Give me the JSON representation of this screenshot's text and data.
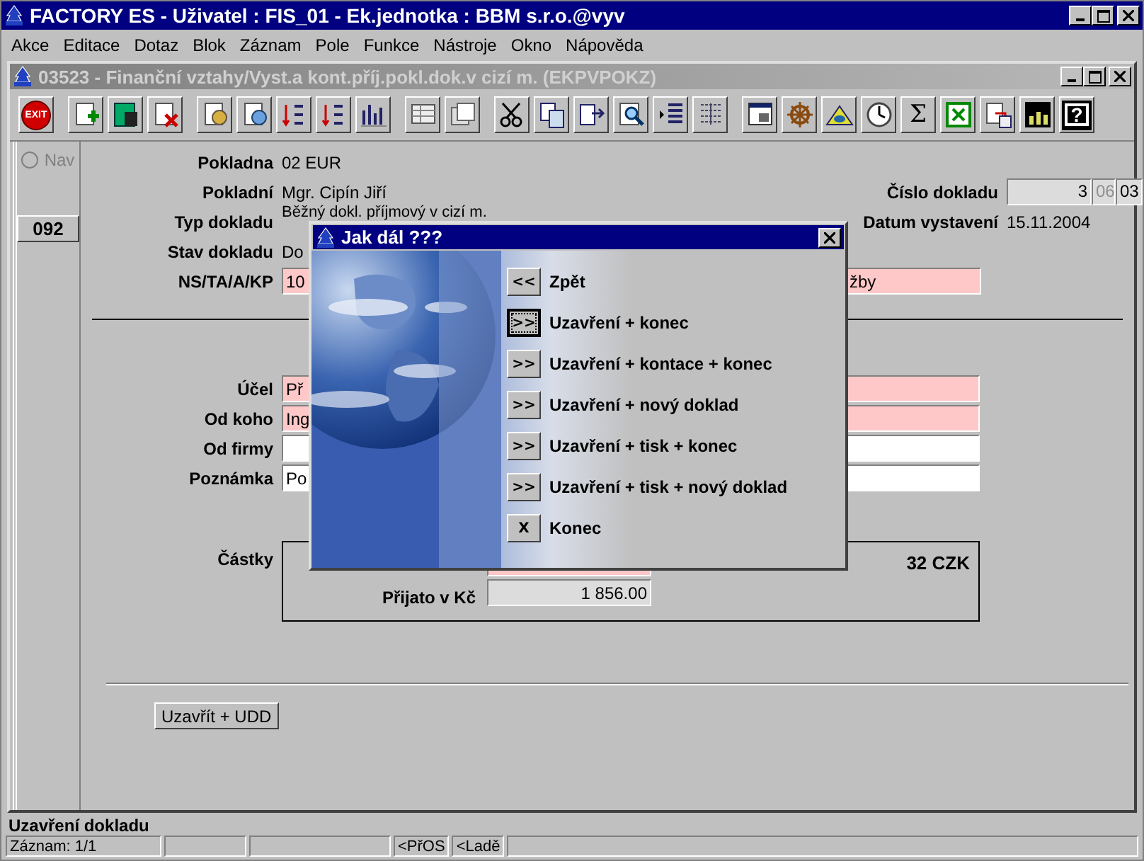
{
  "app_window": {
    "title": "FACTORY ES - Uživatel : FIS_01 - Ek.jednotka : BBM s.r.o.@vyv"
  },
  "menu": [
    "Akce",
    "Editace",
    "Dotaz",
    "Blok",
    "Záznam",
    "Pole",
    "Funkce",
    "Nástroje",
    "Okno",
    "Nápověda"
  ],
  "document_window": {
    "title": "03523 - Finanční vztahy/Vyst.a kont.příj.pokl.dok.v cizí m. (EKPVPOKZ)"
  },
  "toolbar": {
    "exit": "EXIT",
    "sigma": "Σ",
    "help": "?"
  },
  "nav": {
    "label": "Nav",
    "selected": false,
    "disabled": true
  },
  "record_button": "092",
  "header_fields": [
    {
      "label": "Pokladna",
      "value": "02 EUR"
    },
    {
      "label": "Pokladní",
      "value": "Mgr. Cipín Jiří"
    },
    {
      "label": "Typ dokladu",
      "value": "Běžný dokl. příjmový v cizí m."
    },
    {
      "label": "Stav dokladu",
      "value": "Do"
    }
  ],
  "document_number": {
    "label": "Číslo dokladu",
    "parts": [
      {
        "text": "3",
        "disabled": false
      },
      {
        "text": "06",
        "disabled": true
      },
      {
        "text": "03",
        "disabled": false
      }
    ]
  },
  "issue_date": {
    "label": "Datum vystavení",
    "value": "15.11.2004"
  },
  "ns_field": {
    "label": "NS/TA/A/KP",
    "value": "10",
    "value_end": "žby",
    "required": true
  },
  "detail_fields": [
    {
      "label": "Účel",
      "value": "Př",
      "required": true
    },
    {
      "label": "Od koho",
      "value": "Ing",
      "required": true
    },
    {
      "label": "Od firmy",
      "required": false
    },
    {
      "label": "Poznámka",
      "value": "Po",
      "required": false
    }
  ],
  "amounts": {
    "label": "Částky",
    "top_field": {
      "required": true
    },
    "rate": "32  CZK",
    "rows": [
      {
        "label": "Přijato v Kč",
        "value": "1 856.00"
      }
    ]
  },
  "action_button": "Uzavřít + UDD",
  "status": {
    "message": "Uzavření dokladu",
    "cells": [
      "Záznam: 1/1",
      "<PřOS",
      "<Ladě"
    ]
  },
  "dialog": {
    "title": "Jak dál ???",
    "options": [
      {
        "symbol": "<<",
        "label": "Zpět",
        "focused": false
      },
      {
        "symbol": ">>",
        "label": "Uzavření + konec",
        "focused": true
      },
      {
        "symbol": ">>",
        "label": "Uzavření + kontace + konec",
        "focused": false
      },
      {
        "symbol": ">>",
        "label": "Uzavření + nový doklad",
        "focused": false
      },
      {
        "symbol": ">>",
        "label": "Uzavření + tisk + konec",
        "focused": false
      },
      {
        "symbol": ">>",
        "label": "Uzavření + tisk + nový doklad",
        "focused": false
      },
      {
        "symbol": "X",
        "label": "Konec",
        "focused": false
      }
    ]
  }
}
